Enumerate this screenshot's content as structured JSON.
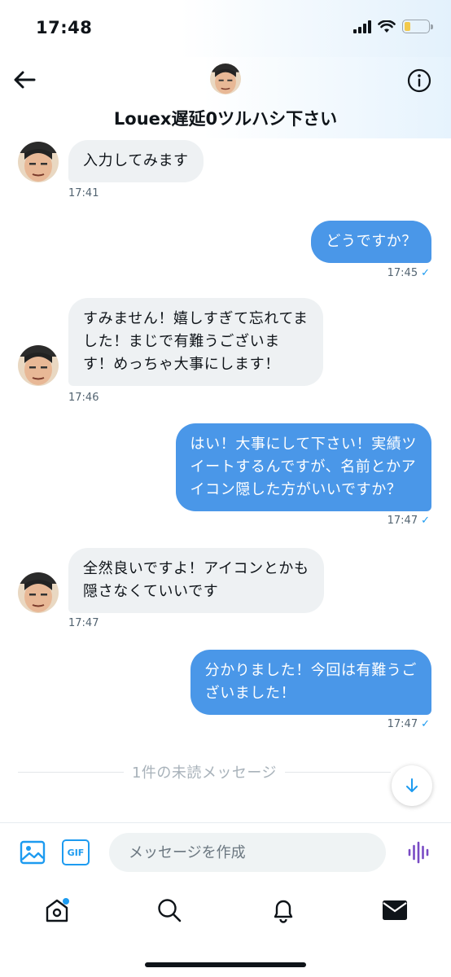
{
  "status": {
    "time": "17:48"
  },
  "header": {
    "title": "Louex遅延0ツルハシ下さい"
  },
  "messages": [
    {
      "dir": "in",
      "text": "入力してみます",
      "time": "17:41"
    },
    {
      "dir": "out",
      "text": "どうですか？",
      "time": "17:45"
    },
    {
      "dir": "in",
      "lines": [
        "すみません！嬉しすぎて忘れてま",
        "した！まじで有難うございま",
        "す！めっちゃ大事にします！"
      ],
      "time": "17:46"
    },
    {
      "dir": "out",
      "lines": [
        "はい！大事にして下さい！実績ツ",
        "イートするんですが、名前とかア",
        "イコン隠した方がいいですか？"
      ],
      "time": "17:47"
    },
    {
      "dir": "in",
      "lines": [
        "全然良いですよ！アイコンとかも",
        "隠さなくていいです"
      ],
      "time": "17:47"
    },
    {
      "dir": "out",
      "lines": [
        "分かりました！今回は有難うご",
        "ざいました！"
      ],
      "time": "17:47"
    }
  ],
  "read_mark": "✓",
  "unread_divider": "1件の未読メッセージ",
  "composer": {
    "gif_label": "GIF",
    "placeholder": "メッセージを作成"
  },
  "colors": {
    "accent": "#1d9bf0",
    "outgoing_bubble": "#4a97e8",
    "incoming_bubble": "#eef1f3",
    "voice": "#794bc4"
  },
  "icons": {
    "back": "arrow-left-icon",
    "info": "info-icon",
    "media": "image-icon",
    "voice": "audio-wave-icon",
    "scroll_down": "arrow-down-icon",
    "tabs": [
      "home-icon",
      "search-icon",
      "bell-icon",
      "envelope-icon"
    ]
  }
}
